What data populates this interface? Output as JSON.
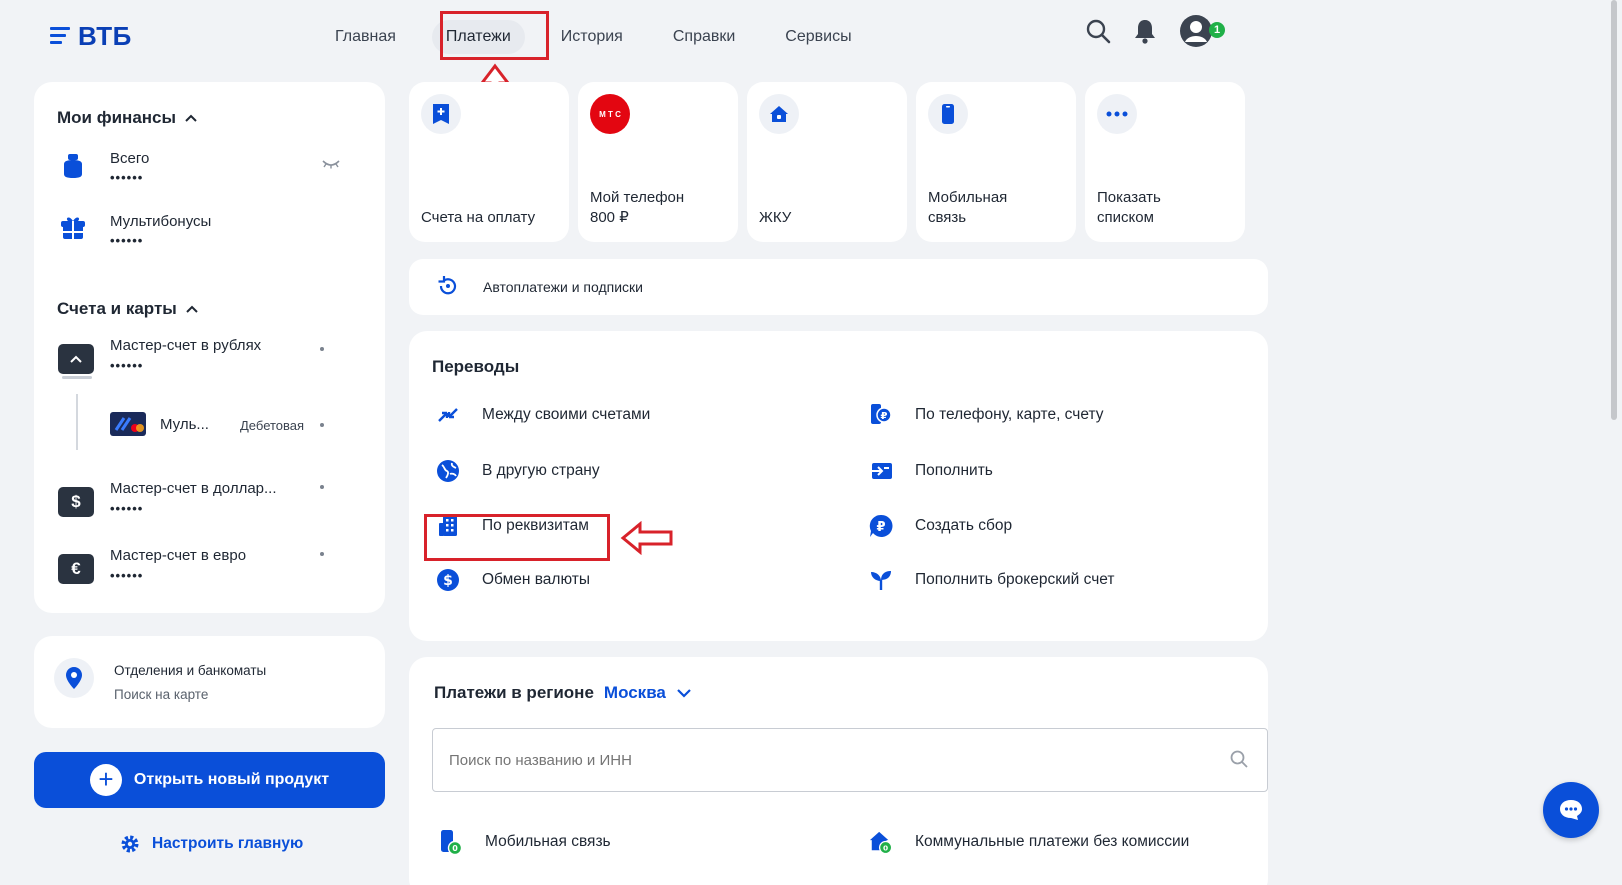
{
  "header": {
    "logo": "ВТБ",
    "nav": [
      "Главная",
      "Платежи",
      "История",
      "Справки",
      "Сервисы"
    ],
    "active_nav": "Платежи",
    "notification_count": "1"
  },
  "finances": {
    "title": "Мои финансы",
    "items": [
      {
        "label": "Всего",
        "value": "••••••"
      },
      {
        "label": "Мультибонусы",
        "value": "••••••"
      }
    ]
  },
  "accounts": {
    "title": "Счета и карты",
    "items": [
      {
        "label": "Мастер-счет в рублях",
        "value": "••••••"
      },
      {
        "label": "Муль...",
        "type": "Дебетовая"
      },
      {
        "label": "Мастер-счет в доллар...",
        "value": "••••••",
        "symbol": "$"
      },
      {
        "label": "Мастер-счет в евро",
        "value": "••••••",
        "symbol": "€"
      }
    ]
  },
  "branches": {
    "title": "Отделения и банкоматы",
    "subtitle": "Поиск на карте"
  },
  "open_product": "Открыть новый продукт",
  "customize": "Настроить главную",
  "tiles": [
    {
      "label": "Счета на оплату"
    },
    {
      "label": "Мой телефон\n800 ₽",
      "logo": "М Т С"
    },
    {
      "label": "ЖКУ"
    },
    {
      "label": "Мобильная\nсвязь"
    },
    {
      "label": "Показать\nсписком"
    }
  ],
  "autopay": "Автоплатежи и подписки",
  "transfers": {
    "title": "Переводы",
    "left": [
      "Между своими счетами",
      "В другую страну",
      "По реквизитам",
      "Обмен валюты"
    ],
    "right": [
      "По телефону, карте, счету",
      "Пополнить",
      "Создать сбор",
      "Пополнить брокерский счет"
    ]
  },
  "region": {
    "title": "Платежи в регионе",
    "city": "Москва",
    "search_placeholder": "Поиск по названию и ИНН",
    "items": [
      "Мобильная связь",
      "Коммунальные платежи без комиссии"
    ]
  },
  "colors": {
    "accent": "#0a4fd9",
    "highlight": "#d8222a",
    "mts": "#e30611",
    "badge": "#20b048"
  }
}
